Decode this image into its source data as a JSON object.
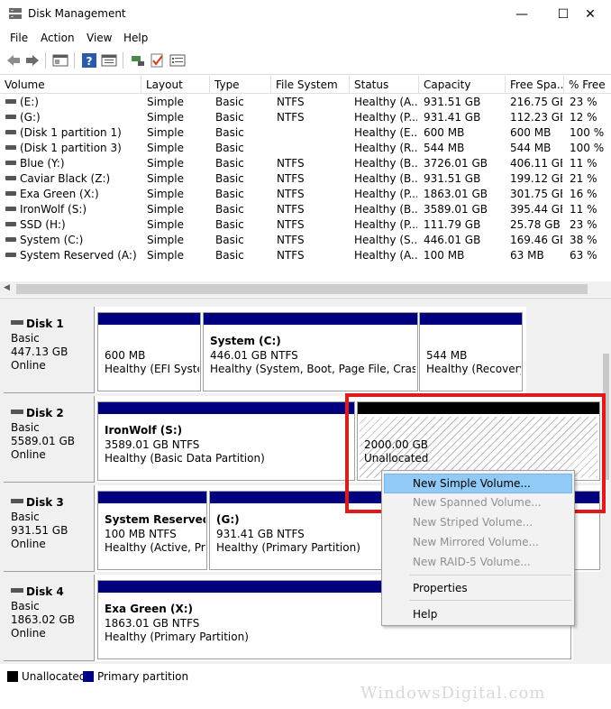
{
  "window": {
    "title": "Disk Management",
    "min_glyph": "—",
    "max_glyph": "☐",
    "close_glyph": "✕"
  },
  "menu": [
    "File",
    "Action",
    "View",
    "Help"
  ],
  "toolbar_icons": [
    "back-arrow-icon",
    "forward-arrow-icon",
    "console-tree-icon",
    "help-icon",
    "properties-icon",
    "connect-icon",
    "check-icon",
    "list-icon"
  ],
  "columns": [
    "Volume",
    "Layout",
    "Type",
    "File System",
    "Status",
    "Capacity",
    "Free Spa...",
    "% Free"
  ],
  "volumes": [
    {
      "name": "(E:)",
      "layout": "Simple",
      "type": "Basic",
      "fs": "NTFS",
      "status": "Healthy (A...",
      "capacity": "931.51 GB",
      "free": "216.75 GB",
      "pct": "23 %"
    },
    {
      "name": "(G:)",
      "layout": "Simple",
      "type": "Basic",
      "fs": "NTFS",
      "status": "Healthy (P...",
      "capacity": "931.41 GB",
      "free": "112.23 GB",
      "pct": "12 %"
    },
    {
      "name": "(Disk 1 partition 1)",
      "layout": "Simple",
      "type": "Basic",
      "fs": "",
      "status": "Healthy (E...",
      "capacity": "600 MB",
      "free": "600 MB",
      "pct": "100 %"
    },
    {
      "name": "(Disk 1 partition 3)",
      "layout": "Simple",
      "type": "Basic",
      "fs": "",
      "status": "Healthy (R...",
      "capacity": "544 MB",
      "free": "544 MB",
      "pct": "100 %"
    },
    {
      "name": "Blue (Y:)",
      "layout": "Simple",
      "type": "Basic",
      "fs": "NTFS",
      "status": "Healthy (B...",
      "capacity": "3726.01 GB",
      "free": "406.11 GB",
      "pct": "11 %"
    },
    {
      "name": "Caviar Black (Z:)",
      "layout": "Simple",
      "type": "Basic",
      "fs": "NTFS",
      "status": "Healthy (B...",
      "capacity": "931.51 GB",
      "free": "199.12 GB",
      "pct": "21 %"
    },
    {
      "name": "Exa Green (X:)",
      "layout": "Simple",
      "type": "Basic",
      "fs": "NTFS",
      "status": "Healthy (P...",
      "capacity": "1863.01 GB",
      "free": "301.75 GB",
      "pct": "16 %"
    },
    {
      "name": "IronWolf (S:)",
      "layout": "Simple",
      "type": "Basic",
      "fs": "NTFS",
      "status": "Healthy (B...",
      "capacity": "3589.01 GB",
      "free": "395.44 GB",
      "pct": "11 %"
    },
    {
      "name": "SSD (H:)",
      "layout": "Simple",
      "type": "Basic",
      "fs": "NTFS",
      "status": "Healthy (P...",
      "capacity": "111.79 GB",
      "free": "25.78 GB",
      "pct": "23 %"
    },
    {
      "name": "System (C:)",
      "layout": "Simple",
      "type": "Basic",
      "fs": "NTFS",
      "status": "Healthy (S...",
      "capacity": "446.01 GB",
      "free": "169.46 GB",
      "pct": "38 %"
    },
    {
      "name": "System Reserved (A:)",
      "layout": "Simple",
      "type": "Basic",
      "fs": "NTFS",
      "status": "Healthy (A...",
      "capacity": "100 MB",
      "free": "63 MB",
      "pct": "63 %"
    }
  ],
  "disks": [
    {
      "name": "Disk 1",
      "type": "Basic",
      "size": "447.13 GB",
      "state": "Online",
      "partitions": [
        {
          "title": "",
          "size": "600 MB",
          "status": "Healthy (EFI System"
        },
        {
          "title": "System  (C:)",
          "size": "446.01 GB NTFS",
          "status": "Healthy (System, Boot, Page File, Crash Du"
        },
        {
          "title": "",
          "size": "544 MB",
          "status": "Healthy (Recovery I"
        }
      ]
    },
    {
      "name": "Disk 2",
      "type": "Basic",
      "size": "5589.01 GB",
      "state": "Online",
      "partitions": [
        {
          "title": "IronWolf  (S:)",
          "size": "3589.01 GB NTFS",
          "status": "Healthy (Basic Data Partition)"
        },
        {
          "title": "",
          "size": "2000.00 GB",
          "status": "Unallocated"
        }
      ]
    },
    {
      "name": "Disk 3",
      "type": "Basic",
      "size": "931.51 GB",
      "state": "Online",
      "partitions": [
        {
          "title": "System Reserved  (",
          "size": "100 MB NTFS",
          "status": "Healthy (Active, Prim"
        },
        {
          "title": "(G:)",
          "size": "931.41 GB NTFS",
          "status": "Healthy (Primary Partition)"
        }
      ]
    },
    {
      "name": "Disk 4",
      "type": "Basic",
      "size": "1863.02 GB",
      "state": "Online",
      "partitions": [
        {
          "title": "Exa Green  (X:)",
          "size": "1863.01 GB NTFS",
          "status": "Healthy (Primary Partition)"
        }
      ]
    }
  ],
  "context_menu": [
    {
      "label": "New Simple Volume...",
      "enabled": true,
      "highlighted": true
    },
    {
      "label": "New Spanned Volume...",
      "enabled": false
    },
    {
      "label": "New Striped Volume...",
      "enabled": false
    },
    {
      "label": "New Mirrored Volume...",
      "enabled": false
    },
    {
      "label": "New RAID-5 Volume...",
      "enabled": false
    },
    {
      "label": "Properties",
      "enabled": true
    },
    {
      "label": "Help",
      "enabled": true
    }
  ],
  "legend": [
    {
      "label": "Unallocated",
      "color": "#000000"
    },
    {
      "label": "Primary partition",
      "color": "#00007f"
    }
  ],
  "colors": {
    "primary": "#00007f",
    "unallocated": "#000000",
    "highlight_box": "#e0191d",
    "menu_highlight": "#91c9f7"
  },
  "watermark": "WindowsDigital.com"
}
